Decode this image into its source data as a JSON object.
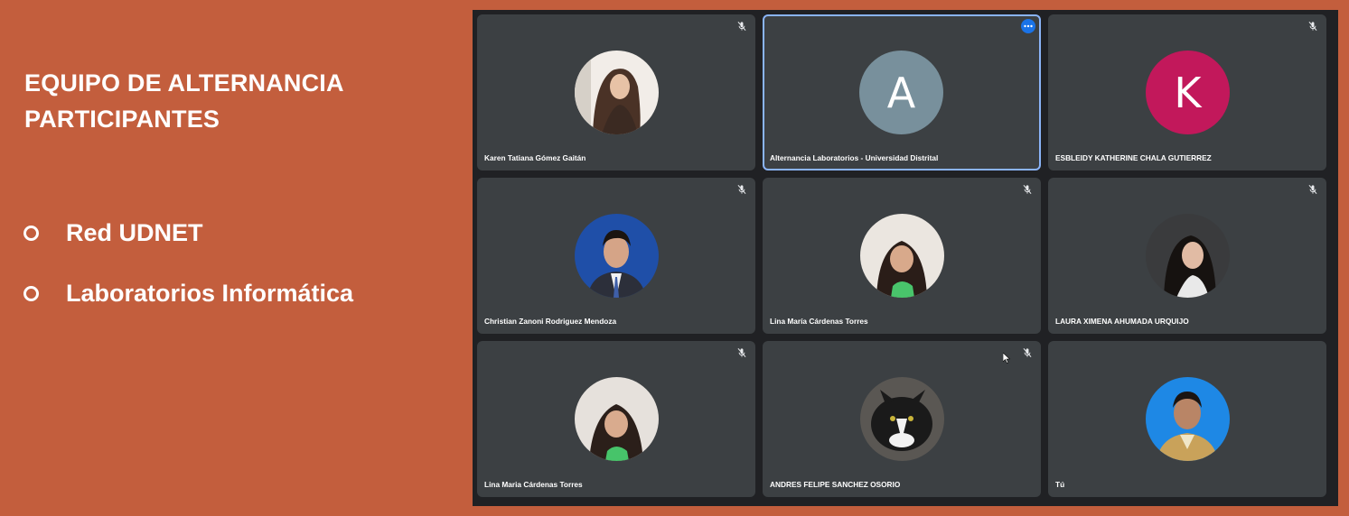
{
  "slide": {
    "title_line1": "EQUIPO DE ALTERNANCIA",
    "title_line2": "PARTICIPANTES",
    "bullets": [
      "Red UDNET",
      "Laboratorios Informática"
    ]
  },
  "colors": {
    "slide_background": "#c35e3d",
    "meet_background": "#202124",
    "tile_background": "#3c4043",
    "active_border": "#8ab4f8",
    "avatar_a": "#78909c",
    "avatar_k": "#c2185b"
  },
  "participants": [
    {
      "name": "Karen Tatiana Gómez Gaitán",
      "avatar": "photo",
      "muted": true
    },
    {
      "name": "Alternancia Laboratorios - Universidad Distrital",
      "avatar": "A",
      "muted": false,
      "active": true,
      "menu_icon": "more-options-icon"
    },
    {
      "name": "ESBLEIDY KATHERINE CHALA GUTIERREZ",
      "avatar": "K",
      "muted": true
    },
    {
      "name": "Christian Zanoni Rodriguez Mendoza",
      "avatar": "photo",
      "muted": true
    },
    {
      "name": "Lina María Cárdenas Torres",
      "avatar": "photo",
      "muted": true
    },
    {
      "name": "LAURA XIMENA AHUMADA URQUIJO",
      "avatar": "photo",
      "muted": true
    },
    {
      "name": "Lina Maria Cárdenas Torres",
      "avatar": "photo",
      "muted": true
    },
    {
      "name": "ANDRES FELIPE SANCHEZ OSORIO",
      "avatar": "photo",
      "muted": true
    },
    {
      "name": "Tú",
      "avatar": "photo",
      "muted": false
    }
  ]
}
